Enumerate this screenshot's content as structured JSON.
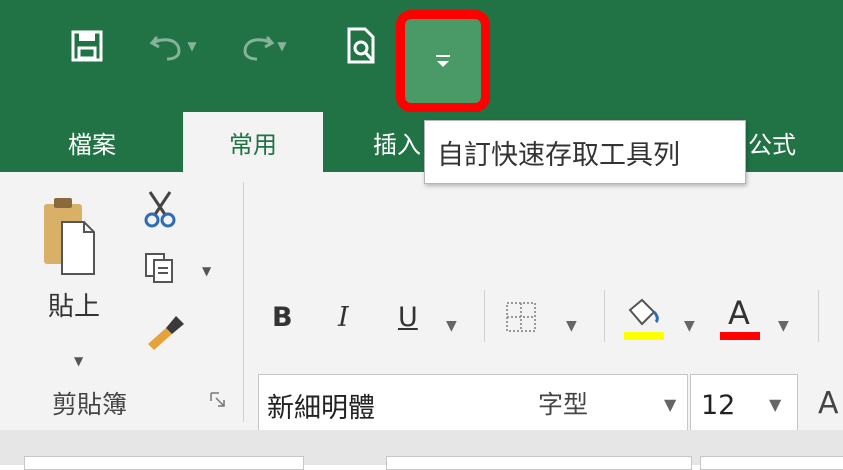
{
  "quick_access": {
    "save_icon": "save-icon",
    "undo_icon": "undo-icon",
    "redo_icon": "redo-icon",
    "print_preview_icon": "print-preview-icon",
    "customize_icon": "customize-quick-access-icon"
  },
  "tooltip": {
    "text": "自訂快速存取工具列"
  },
  "tabs": [
    {
      "label": "檔案"
    },
    {
      "label": "常用"
    },
    {
      "label": "插入"
    },
    {
      "label": "公式"
    }
  ],
  "clipboard": {
    "paste_label": "貼上",
    "group_label": "剪貼簿"
  },
  "font": {
    "font_name": "新細明體",
    "font_size": "12",
    "bold_label": "B",
    "italic_label": "I",
    "underline_label": "U",
    "font_color_label": "A",
    "grow_font_label": "A",
    "group_label": "字型",
    "highlight_color": "#ffff00",
    "font_color": "#ff0000"
  },
  "colors": {
    "brand": "#217346",
    "customize_highlight": "#4a9a67",
    "annotation": "#ff0000"
  }
}
